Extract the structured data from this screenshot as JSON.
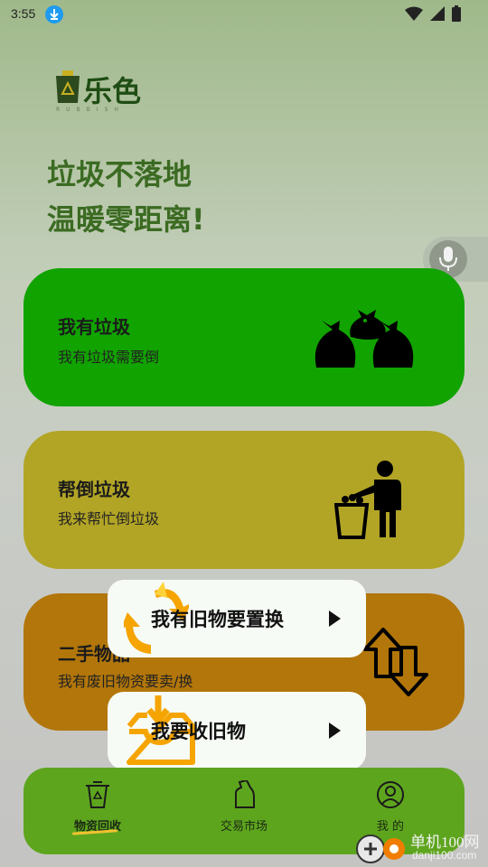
{
  "status": {
    "time": "3:55"
  },
  "logo": {
    "text": "乐色",
    "sub": "RUBBISH"
  },
  "slogan": {
    "line1": "垃圾不落地",
    "line2": "温暖零距离!"
  },
  "cards": [
    {
      "title": "我有垃圾",
      "subtitle": "我有垃圾需要倒",
      "color": "#11a300",
      "icon": "garbage-bags-icon"
    },
    {
      "title": "帮倒垃圾",
      "subtitle": "我来帮忙倒垃圾",
      "color": "#b2a526",
      "icon": "person-trash-can-icon"
    },
    {
      "title": "二手物品",
      "subtitle": "我有废旧物资要卖/换",
      "color": "#b2760a",
      "icon": "swap-arrows-icon"
    }
  ],
  "popup": {
    "option1": "我有旧物要置换",
    "option2": "我要收旧物"
  },
  "nav": {
    "items": [
      {
        "label": "物资回收",
        "icon": "recycle-bin-icon"
      },
      {
        "label": "交易市场",
        "icon": "bottle-icon"
      },
      {
        "label": "我 的",
        "icon": "user-icon"
      }
    ]
  },
  "watermark": {
    "name": "单机100网",
    "url": "danji100.com"
  }
}
